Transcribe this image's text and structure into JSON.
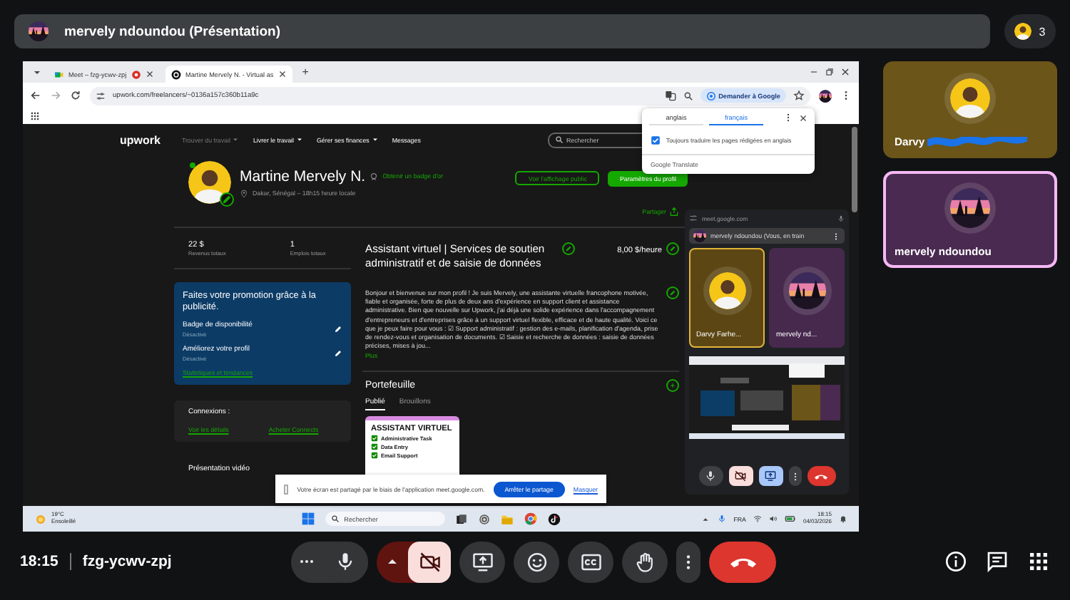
{
  "header": {
    "title": "mervely ndoundou (Présentation)",
    "participant_count": "3"
  },
  "shared_screen": {
    "browser": {
      "tabs": [
        {
          "label": "Meet – fzg-ycwv-zpj",
          "selected": false,
          "recording": true
        },
        {
          "label": "Martine Mervely N. - Virtual as",
          "selected": true,
          "recording": false
        }
      ],
      "new_tab": "+",
      "url": "upwork.com/freelancers/~0136a157c360b11a9c",
      "ask_google": "Demander à Google"
    },
    "translate_popup": {
      "languages": [
        {
          "label": "anglais",
          "selected": false
        },
        {
          "label": "français",
          "selected": true
        }
      ],
      "always_translate": {
        "label": "Toujours traduire les pages rédigées en anglais",
        "checked": true
      },
      "footer": "Google Translate"
    },
    "page": {
      "logo": "upwork",
      "nav": [
        {
          "label": "Trouver du travail",
          "menu": true,
          "dimmed": true
        },
        {
          "label": "Livrer le travail",
          "menu": true,
          "dimmed": false
        },
        {
          "label": "Gérer ses finances",
          "menu": true,
          "dimmed": false
        },
        {
          "label": "Messages",
          "menu": false,
          "dimmed": false
        }
      ],
      "search_placeholder": "Rechercher",
      "profile": {
        "name": "Martine Mervely N.",
        "badge_link": "Obtenir un badge d'or",
        "location": "Dakar, Sénégal – 18h15 heure locale",
        "public_view": "Voir l'affichage public",
        "settings": "Paramètres du profil",
        "share": "Partager",
        "online": true
      },
      "stats": [
        {
          "value": "22 $",
          "label": "Revenus totaux"
        },
        {
          "value": "1",
          "label": "Emplois totaux"
        }
      ],
      "promo": {
        "title": "Faites votre promotion grâce à la publicité.",
        "items": [
          {
            "label": "Badge de disponibilité",
            "status": "Désactivé"
          },
          {
            "label": "Améliorez votre profil",
            "status": "Désactivé"
          }
        ],
        "link": "Statistiques et tendances"
      },
      "connects": {
        "title": "Connexions :",
        "links": [
          "Voir les détails",
          "Acheter Connects"
        ]
      },
      "video_title": "Présentation vidéo",
      "title": "Assistant virtuel | Services de soutien administratif et de saisie de données",
      "rate": "8,00 $/heure",
      "bio": "Bonjour et bienvenue sur mon profil ! Je suis Mervely, une assistante virtuelle francophone motivée, fiable et organisée, forte de plus de deux ans d'expérience en support client et assistance administrative. Bien que nouvelle sur Upwork, j'ai déjà une solide expérience dans l'accompagnement d'entrepreneurs et d'entreprises grâce à un support virtuel flexible, efficace et de haute qualité. Voici ce que je peux faire pour vous : ☑ Support administratif : gestion des e-mails, planification d'agenda, prise de rendez-vous et organisation de documents. ☑ Saisie et recherche de données : saisie de données précises, mises à jou...",
      "more": "Plus",
      "portfolio": {
        "title": "Portefeuille",
        "tabs": [
          {
            "label": "Publié",
            "selected": true
          },
          {
            "label": "Brouillons",
            "selected": false
          }
        ],
        "card": {
          "title": "ASSISTANT VIRTUEL",
          "items": [
            "Administrative Task",
            "Data Entry",
            "Email Support"
          ]
        }
      }
    },
    "share_notice": {
      "text": "Votre écran est partagé par le biais de l'application meet.google.com.",
      "stop": "Arrêter le partage",
      "hide": "Masquer"
    },
    "meet_pip": {
      "origin": "meet.google.com",
      "presenter": "mervely ndoundou (Vous, en train",
      "mic_on": true,
      "camera_on": false,
      "tiles": [
        {
          "name": "Darvy Farhe...",
          "kind": "person",
          "highlighted": true
        },
        {
          "name": "mervely nd...",
          "kind": "landscape",
          "highlighted": false
        }
      ]
    },
    "taskbar": {
      "temperature": "19°C",
      "weather": "Ensoleillé",
      "search_placeholder": "Rechercher",
      "language": "FRA",
      "time": "18:15",
      "date": "04/03/2026"
    }
  },
  "participants": [
    {
      "name": "Darvy",
      "name_redacted": true,
      "kind": "person",
      "color": "#6b5519",
      "highlighted": false
    },
    {
      "name": "mervely ndoundou",
      "name_redacted": false,
      "kind": "landscape",
      "color": "#4a2a50",
      "highlighted": true
    }
  ],
  "bottom_bar": {
    "time": "18:15",
    "meeting_code": "fzg-ycwv-zpj",
    "mic_on": true,
    "camera_on": false
  }
}
